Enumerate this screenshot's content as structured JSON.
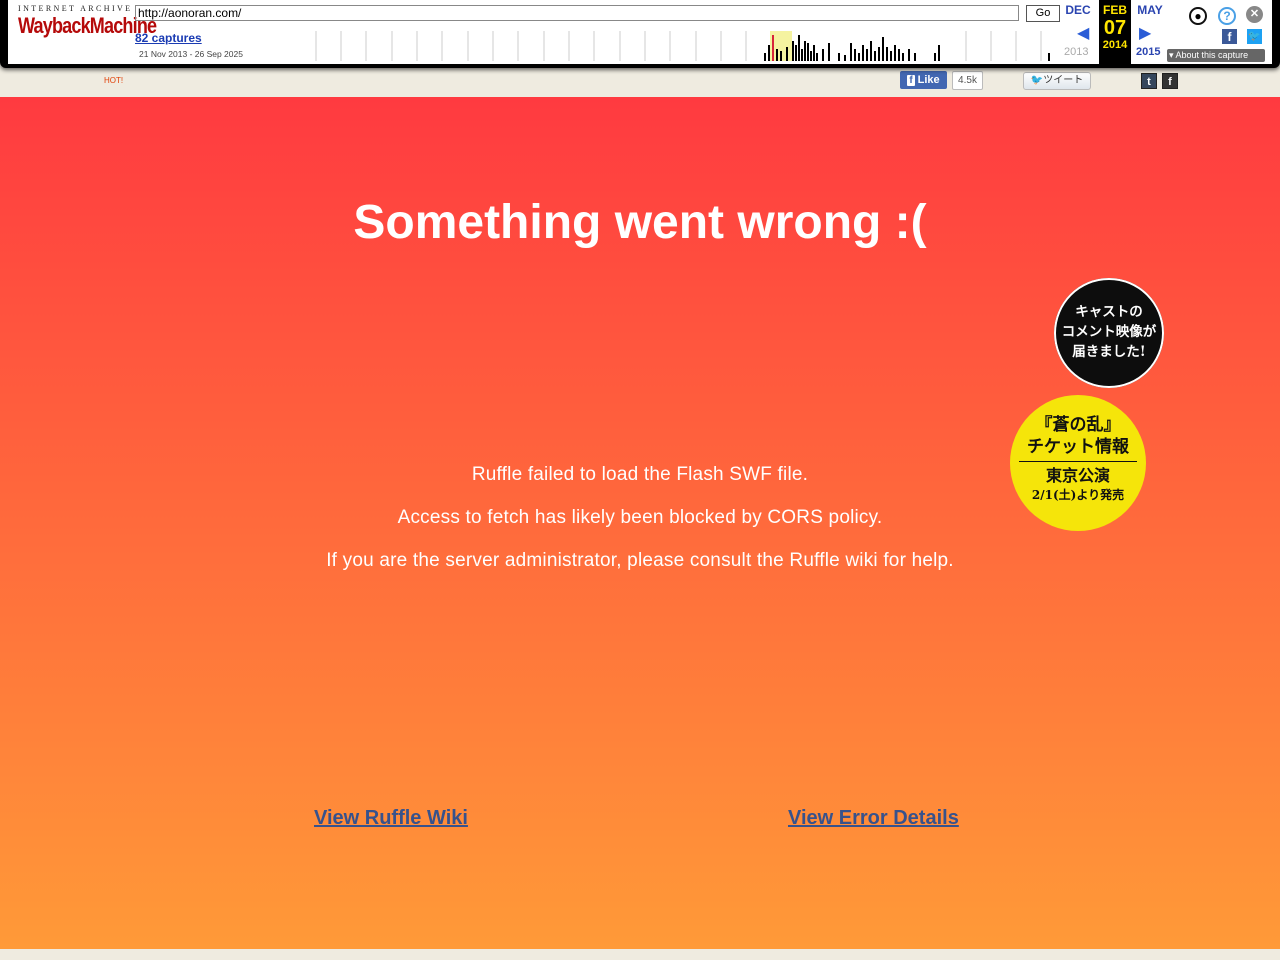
{
  "wayback": {
    "logo_top": "INTERNET ARCHIVE",
    "logo_main": "WaybackMachine",
    "url": "http://aonoran.com/",
    "go_label": "Go",
    "captures": "82 captures",
    "range": "21 Nov 2013 - 26 Sep 2025",
    "prev_month": "DEC",
    "cur_month": "FEB",
    "next_month": "MAY",
    "cur_day": "07",
    "prev_year": "2013",
    "cur_year": "2014",
    "next_year": "2015",
    "about": "About this capture",
    "icons": {
      "user": "user-icon",
      "help": "help-icon",
      "close": "close-icon",
      "facebook": "facebook-icon",
      "twitter": "twitter-icon"
    }
  },
  "strip": {
    "hot": "HOT!",
    "fb_like": "Like",
    "fb_count": "4.5k",
    "tweet": "ツイート",
    "tumblr": "t",
    "fb_share": "f"
  },
  "ruffle": {
    "title": "Something went wrong :(",
    "line1": "Ruffle failed to load the Flash SWF file.",
    "line2": "Access to fetch has likely been blocked by CORS policy.",
    "line3": "If you are the server administrator, please consult the Ruffle wiki for help.",
    "link_wiki": "View Ruffle Wiki",
    "link_error": "View Error Details",
    "colors": {
      "top": "#ff3a40",
      "bottom": "#ff9a38",
      "link": "#37528c"
    }
  },
  "badges": {
    "cast_line1": "キャストの",
    "cast_line2": "コメント映像が",
    "cast_line3": "届きました!",
    "ticket_line1": "『蒼の乱』",
    "ticket_line2": "チケット情報",
    "ticket_line3": "東京公演",
    "ticket_line4": "2/1(土)より発売"
  }
}
